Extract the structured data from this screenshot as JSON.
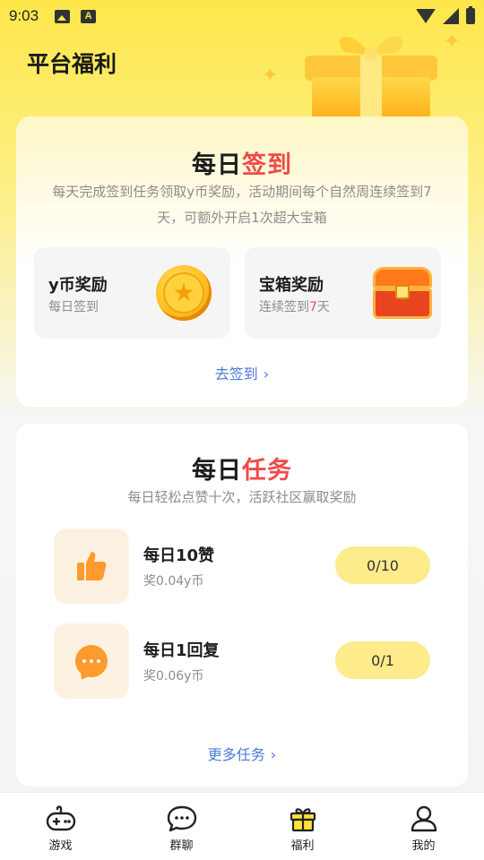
{
  "status_bar": {
    "time": "9:03",
    "notif_icons": [
      "image-icon",
      "a-icon"
    ],
    "right_icons": [
      "wifi-icon",
      "signal-icon",
      "battery-icon"
    ]
  },
  "page": {
    "title": "平台福利"
  },
  "signin_card": {
    "heading_dark": "每日",
    "heading_red": "签到",
    "desc_line1": "每天完成签到任务领取y币奖励，活动期间每个自然周连续签到7",
    "desc_line2": "天，可额外开启1次超大宝箱",
    "coin_reward": {
      "title": "y币奖励",
      "sub": "每日签到"
    },
    "chest_reward": {
      "title": "宝箱奖励",
      "sub_prefix": "连续签到",
      "sub_highlight": "7",
      "sub_suffix": "天"
    },
    "link": "去签到"
  },
  "tasks_card": {
    "heading_dark": "每日",
    "heading_red": "任务",
    "desc": "每日轻松点赞十次，活跃社区赢取奖励",
    "tasks": [
      {
        "name": "每日10赞",
        "reward": "奖0.04y币",
        "progress": "0/10",
        "icon": "thumbs-up-icon"
      },
      {
        "name": "每日1回复",
        "reward": "奖0.06y币",
        "progress": "0/1",
        "icon": "chat-bubble-icon"
      }
    ],
    "link": "更多任务"
  },
  "bottom_nav": {
    "items": [
      {
        "label": "游戏",
        "icon": "gamepad-icon"
      },
      {
        "label": "群聊",
        "icon": "chat-icon"
      },
      {
        "label": "福利",
        "icon": "gift-icon",
        "active": true
      },
      {
        "label": "我的",
        "icon": "user-icon"
      }
    ]
  },
  "colors": {
    "accent_yellow": "#fde74a",
    "accent_red": "#f04a4a",
    "link_blue": "#4a7bd6",
    "pill_yellow": "#fdeb8c"
  }
}
